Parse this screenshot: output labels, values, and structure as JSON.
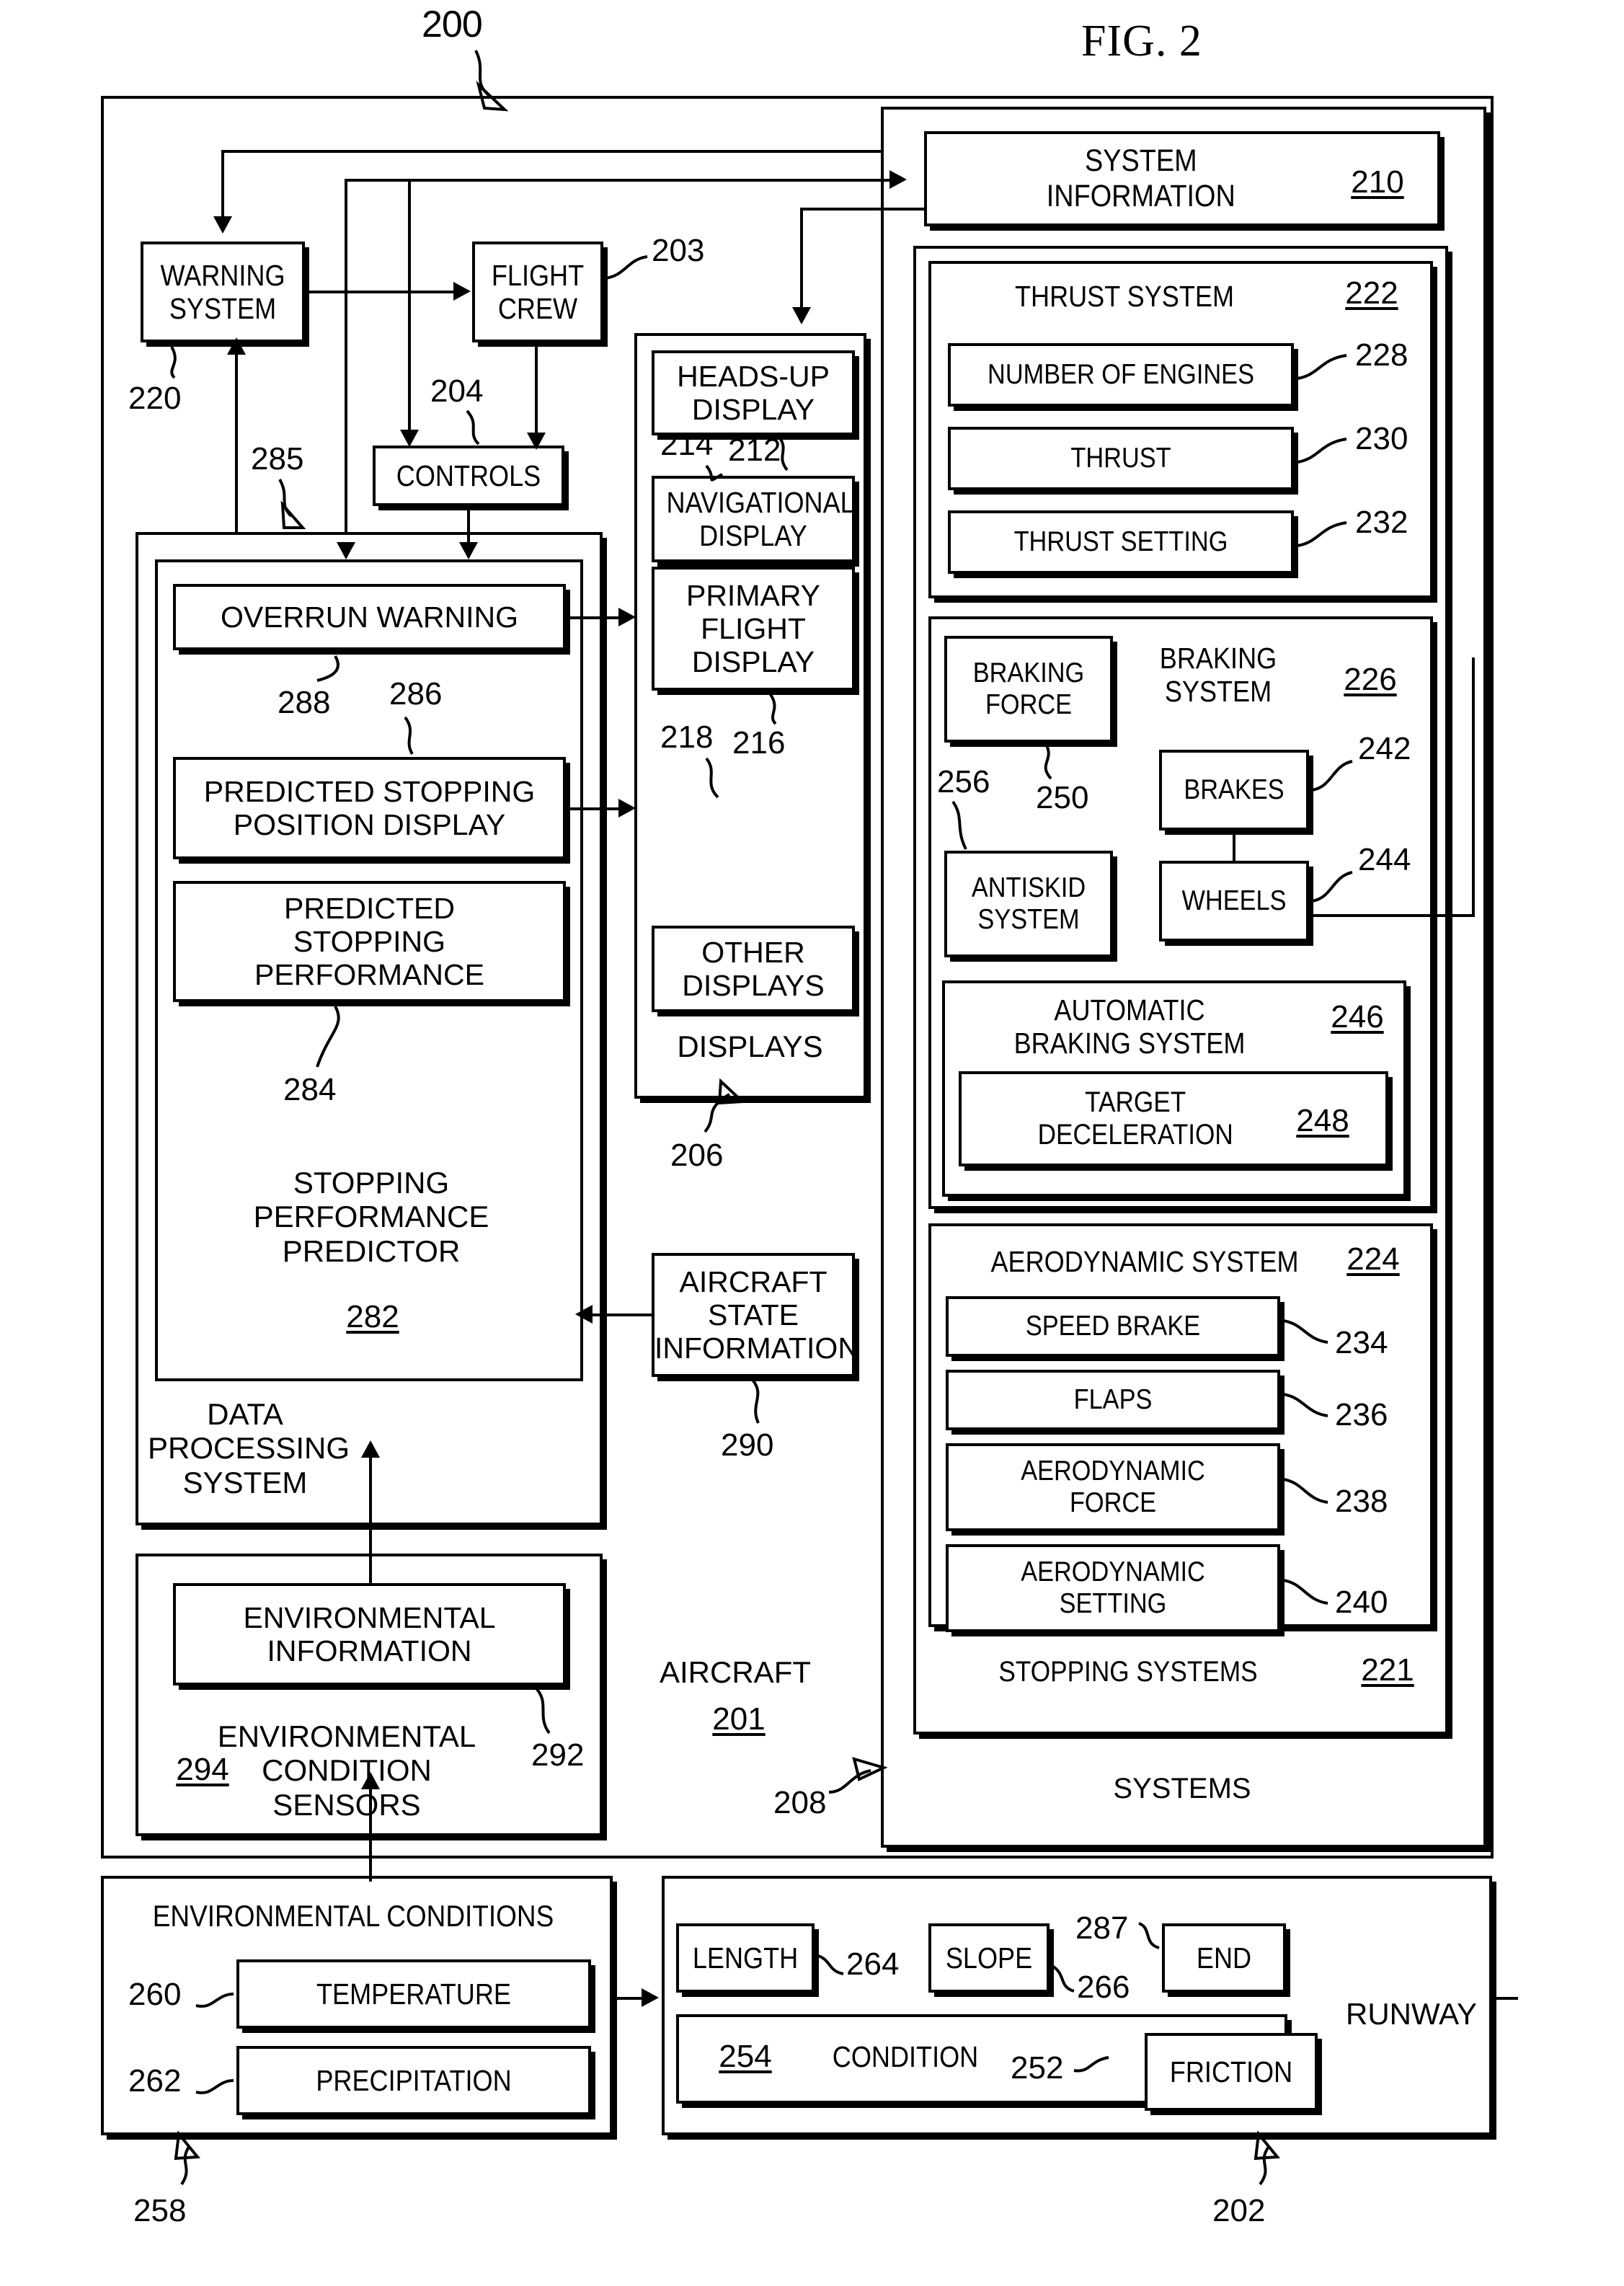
{
  "figure": {
    "title": "FIG. 2",
    "root_ref": "200"
  },
  "aircraft": {
    "label": "AIRCRAFT",
    "ref": "201"
  },
  "top_level": {
    "warning_system": {
      "label": "WARNING\nSYSTEM",
      "ref": "220"
    },
    "flight_crew": {
      "label": "FLIGHT\nCREW",
      "ref": "203"
    },
    "controls": {
      "label": "CONTROLS",
      "ref": "204"
    },
    "link_285": "285"
  },
  "data_processing_system": {
    "label": "DATA\nPROCESSING\nSYSTEM",
    "stopping_performance_predictor": {
      "label": "STOPPING\nPERFORMANCE\nPREDICTOR",
      "ref": "282"
    },
    "items": [
      {
        "label": "OVERRUN WARNING",
        "ref": "288"
      },
      {
        "label": "PREDICTED STOPPING\nPOSITION DISPLAY",
        "ref": "286"
      },
      {
        "label": "PREDICTED\nSTOPPING\nPERFORMANCE",
        "ref": "284"
      }
    ]
  },
  "environmental_condition_sensors": {
    "label": "ENVIRONMENTAL\nCONDITION\nSENSORS",
    "ref": "294",
    "information": {
      "label": "ENVIRONMENTAL\nINFORMATION",
      "ref": "292"
    }
  },
  "displays": {
    "label": "DISPLAYS",
    "ref": "206",
    "items": [
      {
        "label": "HEADS-UP\nDISPLAY",
        "ref": "212"
      },
      {
        "label": "NAVIGATIONAL\nDISPLAY",
        "ref": "214"
      },
      {
        "label": "PRIMARY\nFLIGHT\nDISPLAY",
        "ref": "216"
      },
      {
        "label": "OTHER\nDISPLAYS",
        "ref": "218"
      }
    ]
  },
  "aircraft_state_information": {
    "label": "AIRCRAFT\nSTATE\nINFORMATION",
    "ref": "290"
  },
  "systems": {
    "label": "SYSTEMS",
    "ref": "208",
    "system_information": {
      "label": "SYSTEM\nINFORMATION",
      "ref": "210"
    },
    "stopping_systems": {
      "label": "STOPPING SYSTEMS",
      "ref": "221"
    },
    "thrust_system": {
      "label": "THRUST SYSTEM",
      "ref": "222",
      "items": [
        {
          "label": "NUMBER OF ENGINES",
          "ref": "228"
        },
        {
          "label": "THRUST",
          "ref": "230"
        },
        {
          "label": "THRUST SETTING",
          "ref": "232"
        }
      ]
    },
    "braking_system": {
      "label": "BRAKING\nSYSTEM",
      "ref": "226",
      "braking_force": {
        "label": "BRAKING\nFORCE",
        "ref": "250"
      },
      "antiskid_system": {
        "label": "ANTISKID\nSYSTEM",
        "ref": "256"
      },
      "brakes": {
        "label": "BRAKES",
        "ref": "242"
      },
      "wheels": {
        "label": "WHEELS",
        "ref": "244"
      },
      "automatic_braking_system": {
        "label": "AUTOMATIC\nBRAKING SYSTEM",
        "ref": "246",
        "target_deceleration": {
          "label": "TARGET\nDECELERATION",
          "ref": "248"
        }
      }
    },
    "aerodynamic_system": {
      "label": "AERODYNAMIC SYSTEM",
      "ref": "224",
      "items": [
        {
          "label": "SPEED BRAKE",
          "ref": "234"
        },
        {
          "label": "FLAPS",
          "ref": "236"
        },
        {
          "label": "AERODYNAMIC\nFORCE",
          "ref": "238"
        },
        {
          "label": "AERODYNAMIC\nSETTING",
          "ref": "240"
        }
      ]
    }
  },
  "environmental_conditions": {
    "label": "ENVIRONMENTAL CONDITIONS",
    "ref": "258",
    "items": [
      {
        "label": "TEMPERATURE",
        "ref": "260"
      },
      {
        "label": "PRECIPITATION",
        "ref": "262"
      }
    ]
  },
  "runway": {
    "label": "RUNWAY",
    "ref": "202",
    "length": {
      "label": "LENGTH",
      "ref": "264"
    },
    "slope": {
      "label": "SLOPE",
      "ref": "266"
    },
    "end": {
      "label": "END",
      "ref": "287"
    },
    "condition": {
      "label": "CONDITION",
      "ref": "254"
    },
    "friction": {
      "label": "FRICTION",
      "ref": "252"
    }
  }
}
